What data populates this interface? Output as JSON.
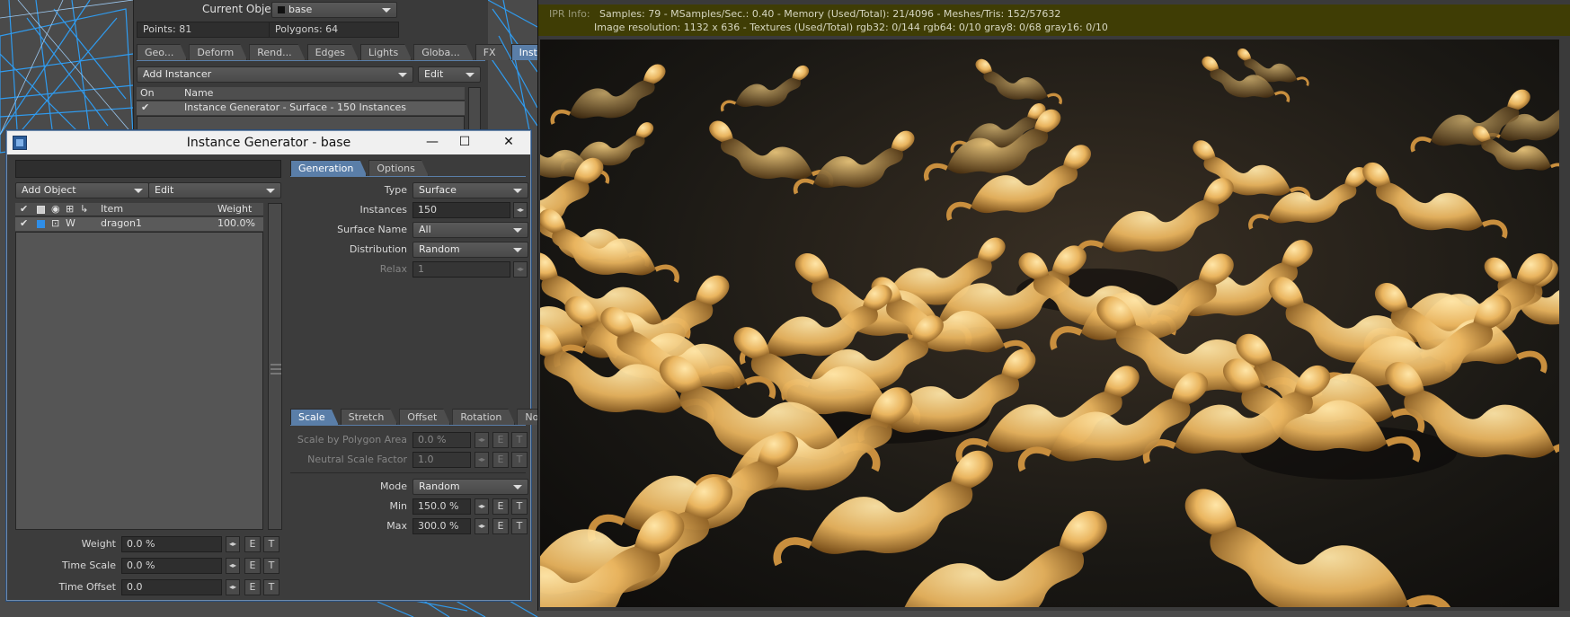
{
  "object_panel": {
    "current_object_label": "Current Object",
    "current_object_value": "base",
    "points": "Points: 81",
    "polygons": "Polygons: 64",
    "tabs": [
      {
        "label": "Geo...",
        "active": false
      },
      {
        "label": "Deform",
        "active": false
      },
      {
        "label": "Rend...",
        "active": false
      },
      {
        "label": "Edges",
        "active": false
      },
      {
        "label": "Lights",
        "active": false
      },
      {
        "label": "Globa...",
        "active": false
      },
      {
        "label": "FX",
        "active": false
      },
      {
        "label": "Instancer",
        "active": true
      }
    ],
    "add_instancer": "Add Instancer",
    "edit": "Edit",
    "list_headers": {
      "on": "On",
      "name": "Name"
    },
    "list_rows": [
      {
        "on": "✔",
        "name": "Instance Generator - Surface - 150 Instances"
      }
    ]
  },
  "instance_generator": {
    "title": "Instance Generator - base",
    "search_value": "",
    "add_object": "Add Object",
    "edit": "Edit",
    "item_headers": {
      "item": "Item",
      "weight": "Weight"
    },
    "items": [
      {
        "check": "✔",
        "flag": "W",
        "name": "dragon1",
        "weight": "100.0%"
      }
    ],
    "weight_label": "Weight",
    "weight_value": "0.0 %",
    "time_scale_label": "Time Scale",
    "time_scale_value": "0.0 %",
    "time_offset_label": "Time Offset",
    "time_offset_value": "0.0",
    "tabs": [
      {
        "label": "Generation",
        "active": true
      },
      {
        "label": "Options",
        "active": false
      }
    ],
    "generation": {
      "type_label": "Type",
      "type_value": "Surface",
      "instances_label": "Instances",
      "instances_value": "150",
      "surface_name_label": "Surface Name",
      "surface_name_value": "All",
      "distribution_label": "Distribution",
      "distribution_value": "Random",
      "relax_label": "Relax",
      "relax_value": "1"
    },
    "sub_tabs": [
      {
        "label": "Scale",
        "active": true
      },
      {
        "label": "Stretch",
        "active": false
      },
      {
        "label": "Offset",
        "active": false
      },
      {
        "label": "Rotation",
        "active": false
      },
      {
        "label": "Nodes",
        "active": false
      }
    ],
    "scale": {
      "scale_by_area_label": "Scale by Polygon Area",
      "scale_by_area_value": "0.0 %",
      "neutral_label": "Neutral Scale Factor",
      "neutral_value": "1.0",
      "mode_label": "Mode",
      "mode_value": "Random",
      "min_label": "Min",
      "min_value": "150.0 %",
      "max_label": "Max",
      "max_value": "300.0 %"
    },
    "e_label": "E",
    "t_label": "T",
    "spin_glyph": "◂▸"
  },
  "ipr": {
    "label": "IPR Info:",
    "line1": "Samples: 79  -  MSamples/Sec.: 0.40  -  Memory (Used/Total): 21/4096  -  Meshes/Tris: 152/57632",
    "line2": "Image resolution: 1132 x 636  -  Textures (Used/Total) rgb32: 0/144   rgb64: 0/10   gray8: 0/68   gray16: 0/10"
  },
  "colors": {
    "accent_tab": "#5a7ea8",
    "ipr_bar": "#3f3d05",
    "wireframe": "#2f9bef",
    "dragon": "#e9b45e"
  }
}
